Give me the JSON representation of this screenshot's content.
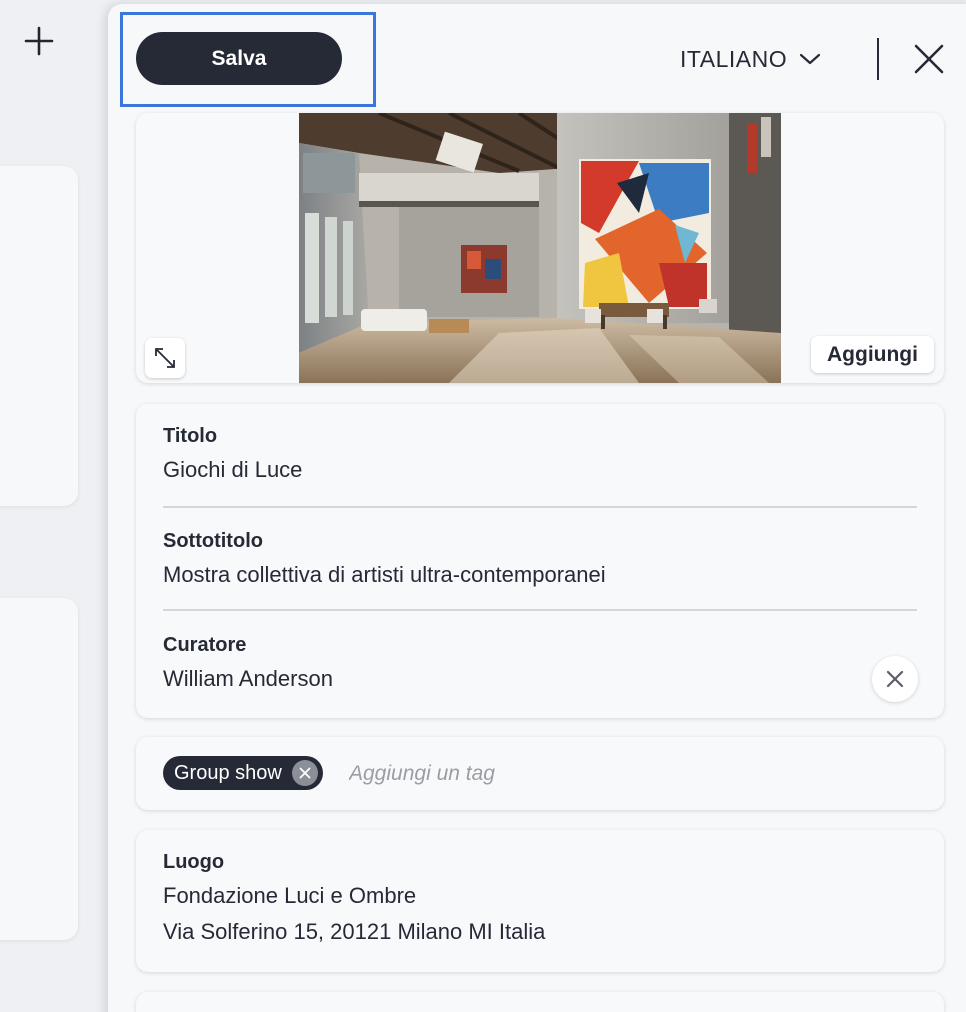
{
  "toolbar": {
    "save_label": "Salva",
    "language": "ITALIANO"
  },
  "image_section": {
    "add_label": "Aggiungi"
  },
  "fields": {
    "title_label": "Titolo",
    "title_value": "Giochi di Luce",
    "subtitle_label": "Sottotitolo",
    "subtitle_value": "Mostra collettiva di artisti ultra-contemporanei",
    "curator_label": "Curatore",
    "curator_value": "William Anderson"
  },
  "tags": {
    "items": [
      "Group show"
    ],
    "placeholder": "Aggiungi un tag"
  },
  "location": {
    "label": "Luogo",
    "name": "Fondazione Luci e Ombre",
    "address": "Via Solferino 15, 20121 Milano MI Italia"
  },
  "colors": {
    "primary_dark": "#262a36",
    "highlight_blue": "#3a77dd",
    "panel_bg": "#f7f8fa"
  },
  "icons": {
    "add": "plus-icon",
    "language_dropdown": "chevron-down-icon",
    "close": "close-icon",
    "expand": "expand-icon",
    "clear": "close-icon",
    "tag_remove": "close-icon",
    "annotation": "arrow-icon"
  }
}
